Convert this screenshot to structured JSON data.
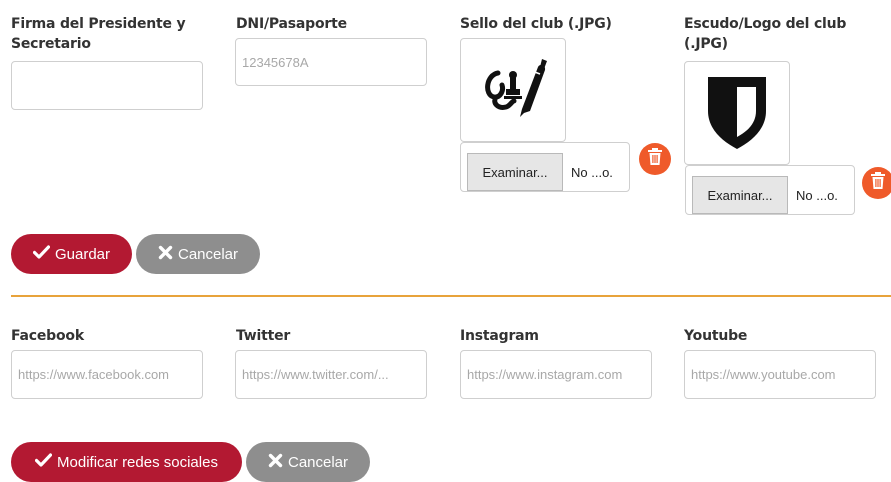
{
  "identity": {
    "signature_label": "Firma del Presidente y Secretario",
    "signature_value": "",
    "dni_label": "DNI/Pasaporte",
    "dni_placeholder": "12345678A",
    "seal_label": "Sello del club (.JPG)",
    "logo_label": "Escudo/Logo del club (.JPG)",
    "browse_label": "Examinar...",
    "seal_filename": "No ...o.",
    "logo_filename": "No ...o.",
    "seal_icon": "signature-stamp-icon",
    "logo_icon": "shield-icon",
    "delete_icon": "trash-icon"
  },
  "actions": {
    "save_label": "Guardar",
    "cancel_label": "Cancelar"
  },
  "social": {
    "facebook_label": "Facebook",
    "facebook_placeholder": "https://www.facebook.com",
    "twitter_label": "Twitter",
    "twitter_placeholder": "https://www.twitter.com/...",
    "instagram_label": "Instagram",
    "instagram_placeholder": "https://www.instagram.com",
    "youtube_label": "Youtube",
    "youtube_placeholder": "https://www.youtube.com",
    "modify_label": "Modificar redes sociales",
    "cancel_label": "Cancelar"
  },
  "colors": {
    "primary_button": "#b31932",
    "secondary_button": "#8e8e8e",
    "divider": "#e8a33b",
    "delete_icon_bg": "#ef5a2a"
  }
}
